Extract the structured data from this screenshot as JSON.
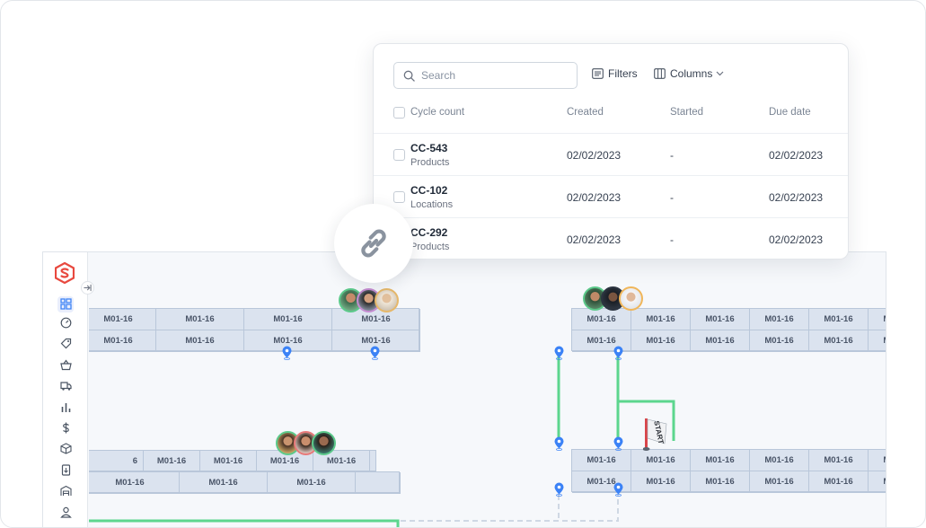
{
  "panel": {
    "search": {
      "placeholder": "Search",
      "value": ""
    },
    "filters_label": "Filters",
    "columns_label": "Columns",
    "headers": [
      "Cycle count",
      "Created",
      "Started",
      "Due date"
    ],
    "rows": [
      {
        "id": "CC-543",
        "type": "Products",
        "created": "02/02/2023",
        "started": "-",
        "due": "02/02/2023"
      },
      {
        "id": "CC-102",
        "type": "Locations",
        "created": "02/02/2023",
        "started": "-",
        "due": "02/02/2023"
      },
      {
        "id": "CC-292",
        "type": "Products",
        "created": "02/02/2023",
        "started": "-",
        "due": "02/02/2023"
      }
    ]
  },
  "link_icon": "link-icon",
  "sidebar": {
    "logo": "brand-s-logo",
    "items": [
      {
        "icon": "grid-icon",
        "active": true
      },
      {
        "icon": "dashboard-gauge-icon",
        "active": false
      },
      {
        "icon": "tag-icon",
        "active": false
      },
      {
        "icon": "basket-icon",
        "active": false
      },
      {
        "icon": "truck-icon",
        "active": false
      },
      {
        "icon": "bar-chart-icon",
        "active": false
      },
      {
        "icon": "dollar-icon",
        "active": false
      },
      {
        "icon": "box-icon",
        "active": false
      },
      {
        "icon": "document-icon",
        "active": false
      },
      {
        "icon": "warehouse-icon",
        "active": false
      },
      {
        "icon": "user-icon",
        "active": false
      }
    ]
  },
  "map": {
    "location_label": "M01-16",
    "partial_label": "6",
    "start_flag": "START"
  },
  "colors": {
    "accent": "#3b82f6",
    "route": "#5cd68e",
    "rack_fill": "#dbe3ef",
    "brand": "#e8493f"
  }
}
